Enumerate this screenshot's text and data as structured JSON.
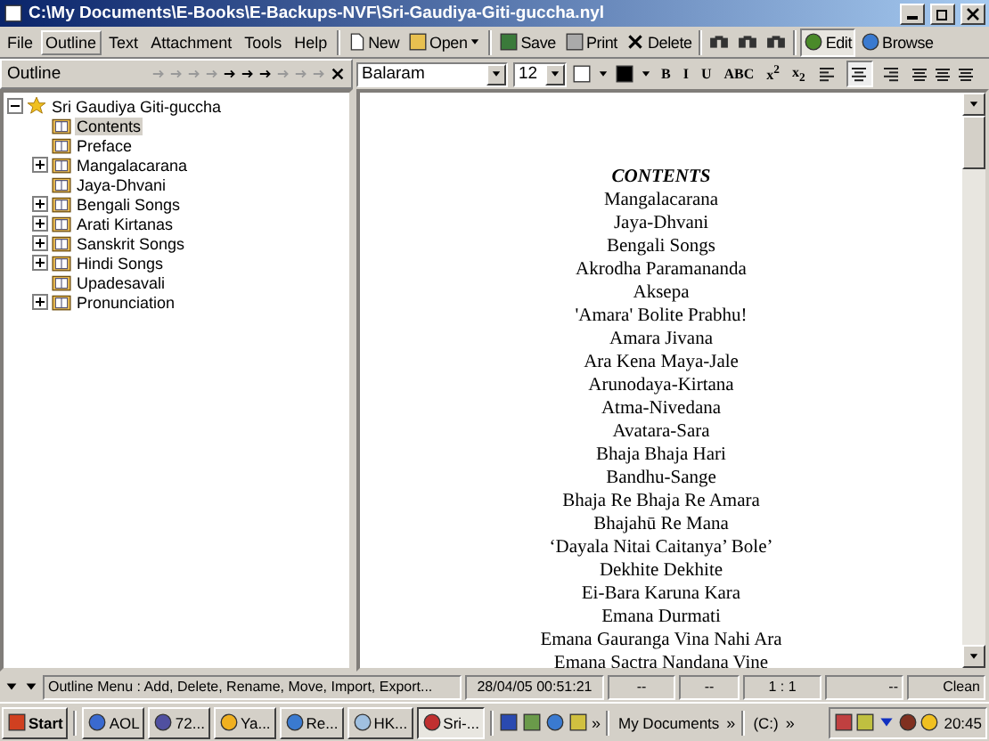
{
  "window": {
    "title": "C:\\My Documents\\E-Books\\E-Backups-NVF\\Sri-Gaudiya-Giti-guccha.nyl"
  },
  "menu": [
    {
      "label": "File",
      "selected": false
    },
    {
      "label": "Outline",
      "selected": true
    },
    {
      "label": "Text",
      "selected": false
    },
    {
      "label": "Attachment",
      "selected": false
    },
    {
      "label": "Tools",
      "selected": false
    },
    {
      "label": "Help",
      "selected": false
    }
  ],
  "toolbar": [
    {
      "kind": "new",
      "label": "New",
      "selected": false
    },
    {
      "kind": "open",
      "label": "Open",
      "selected": false
    },
    {
      "kind": "save",
      "label": "Save",
      "selected": false
    },
    {
      "kind": "print",
      "label": "Print",
      "selected": false
    },
    {
      "kind": "delete",
      "label": "Delete",
      "selected": false
    },
    {
      "kind": "find",
      "selected": false
    },
    {
      "kind": "find",
      "selected": false
    },
    {
      "kind": "find",
      "selected": false
    },
    {
      "kind": "edit",
      "label": "Edit",
      "selected": true
    },
    {
      "kind": "browse",
      "label": "Browse",
      "selected": false
    }
  ],
  "outline_header": {
    "title": "Outline"
  },
  "format_bar": {
    "font": "Balaram",
    "size": "12",
    "styles": [
      "B",
      "I",
      "U",
      "ABC",
      "x$^{2}$",
      "x$_{2}$"
    ],
    "alignments": [
      {
        "kind": "left",
        "selected": false
      },
      {
        "kind": "center",
        "selected": true
      },
      {
        "kind": "right",
        "selected": false
      }
    ]
  },
  "tree": {
    "label": "Sri Gaudiya Giti-guccha",
    "expanded": true,
    "children": [
      {
        "label": "Contents",
        "kind": "leaf",
        "selected": true
      },
      {
        "label": "Preface",
        "kind": "leaf",
        "selected": false
      },
      {
        "label": "Mangalacarana",
        "kind": "group",
        "selected": false
      },
      {
        "label": "Jaya-Dhvani",
        "kind": "leaf",
        "selected": false
      },
      {
        "label": "Bengali Songs",
        "kind": "group",
        "selected": false
      },
      {
        "label": "Arati Kirtanas",
        "kind": "group",
        "selected": false
      },
      {
        "label": "Sanskrit Songs",
        "kind": "group",
        "selected": false
      },
      {
        "label": "Hindi Songs",
        "kind": "group",
        "selected": false
      },
      {
        "label": "Upadesavali",
        "kind": "leaf",
        "selected": false
      },
      {
        "label": "Pronunciation",
        "kind": "group",
        "selected": false
      }
    ]
  },
  "document": {
    "heading": "CONTENTS",
    "lines": [
      "Mangalacarana",
      "Jaya-Dhvani",
      "Bengali Songs",
      "Akrodha Paramananda",
      "Aksepa",
      "'Amara' Bolite Prabhu!",
      "Amara Jivana",
      "Ara Kena Maya-Jale",
      "Arunodaya-Kirtana",
      "Atma-Nivedana",
      "Avatara-Sara",
      "Bhaja Bhaja Hari",
      "Bandhu-Sange",
      "Bhaja Re Bhaja Re Amara",
      "Bhajahū Re Mana",
      "‘Dayala Nitai Caitanya’ Bole’",
      "Dekhite Dekhite",
      "Ei-Bara Karuna Kara",
      "Emana Durmati",
      "Emana Gauranga Vina Nahi Ara",
      "Emana Sactra Nandana Vine"
    ]
  },
  "status_bar": {
    "message": "Outline Menu : Add, Delete, Rename, Move, Import, Export...",
    "date": "28/04/05 00:51:21",
    "field_3": "--",
    "field_4": "--",
    "position": "1 : 1",
    "field_6": "--",
    "state": "Clean"
  },
  "taskbar": {
    "start": "Start",
    "tasks": [
      {
        "label": "AOL",
        "selected": false
      },
      {
        "label": "72...",
        "selected": false
      },
      {
        "label": "Ya...",
        "selected": false
      },
      {
        "label": "Re...",
        "selected": false
      },
      {
        "label": "HK...",
        "selected": false
      },
      {
        "label": "Sri-...",
        "selected": true
      }
    ],
    "toolbars": [
      "My Documents",
      "(C:)"
    ],
    "chevron": "»",
    "clock": "20:45"
  }
}
